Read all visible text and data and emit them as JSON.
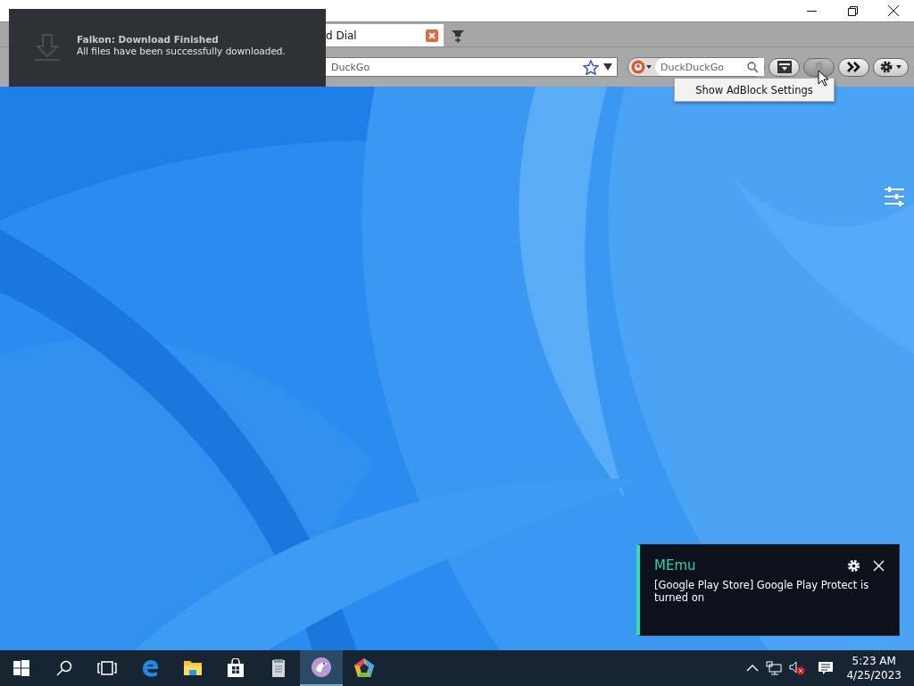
{
  "browser": {
    "tab": {
      "label": "d Dial",
      "selected": true
    },
    "address_bar": {
      "value": "DuckGo"
    },
    "search_box": {
      "placeholder": "DuckDuckGo"
    },
    "toolbar_buttons": [
      {
        "kind": "downloads",
        "hovered": false
      },
      {
        "kind": "adblock",
        "hovered": true
      },
      {
        "kind": "more",
        "hovered": false
      },
      {
        "kind": "settings",
        "hovered": false
      }
    ],
    "tooltip": "Show AdBlock Settings"
  },
  "download_notification": {
    "title": "Falkon: Download Finished",
    "message": "All files have been successfully downloaded."
  },
  "memu_toast": {
    "title": "MEmu",
    "message": "[Google Play Store] Google Play Protect is turned on"
  },
  "taskbar": {
    "apps": [
      {
        "kind": "start",
        "active": false
      },
      {
        "kind": "search",
        "active": false
      },
      {
        "kind": "task-view",
        "active": false
      },
      {
        "kind": "edge",
        "active": false
      },
      {
        "kind": "explorer",
        "active": false
      },
      {
        "kind": "store",
        "active": false
      },
      {
        "kind": "notepad",
        "active": false
      },
      {
        "kind": "falkon",
        "active": true
      },
      {
        "kind": "memu",
        "active": false
      }
    ],
    "clock": {
      "time": "5:23 AM",
      "date": "4/25/2023"
    }
  }
}
